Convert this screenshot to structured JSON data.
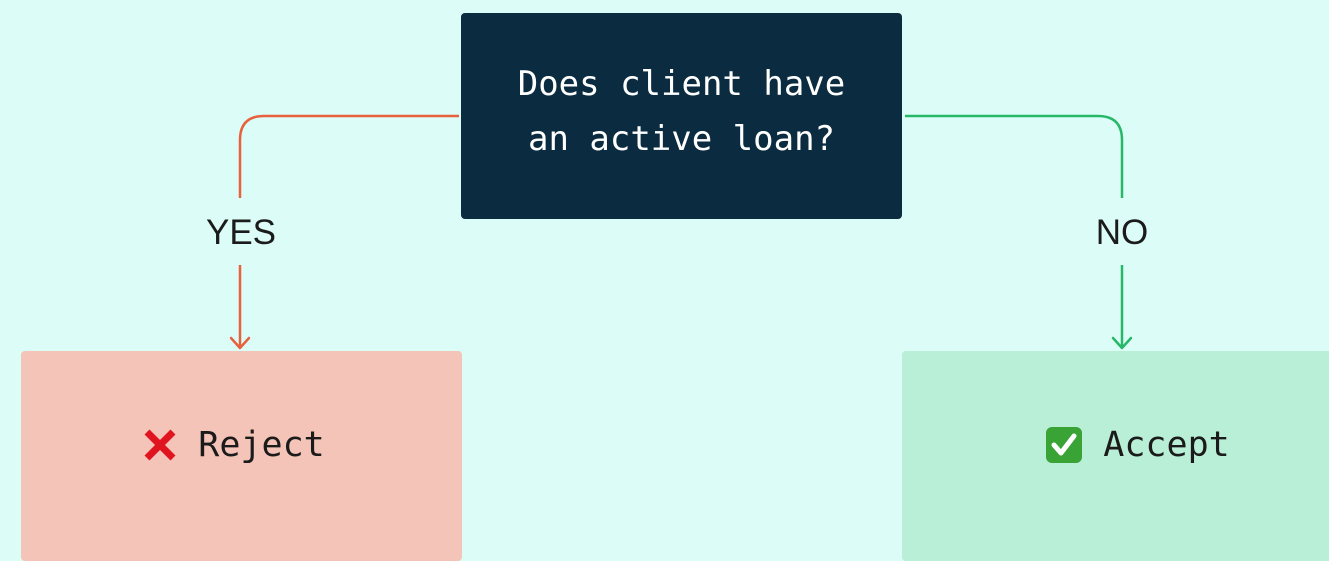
{
  "decision": {
    "line1": "Does client have",
    "line2": "an active loan?"
  },
  "branches": {
    "yes_label": "YES",
    "no_label": "NO"
  },
  "outcomes": {
    "reject": {
      "label": "Reject",
      "icon": "cross-mark-icon",
      "color": "#f5c4b8"
    },
    "accept": {
      "label": "Accept",
      "icon": "check-mark-button-icon",
      "color": "#b8efd6"
    }
  },
  "colors": {
    "background": "#dcfdf7",
    "decision_box": "#0b2c40",
    "yes_connector": "#e8613e",
    "no_connector": "#27b768"
  }
}
